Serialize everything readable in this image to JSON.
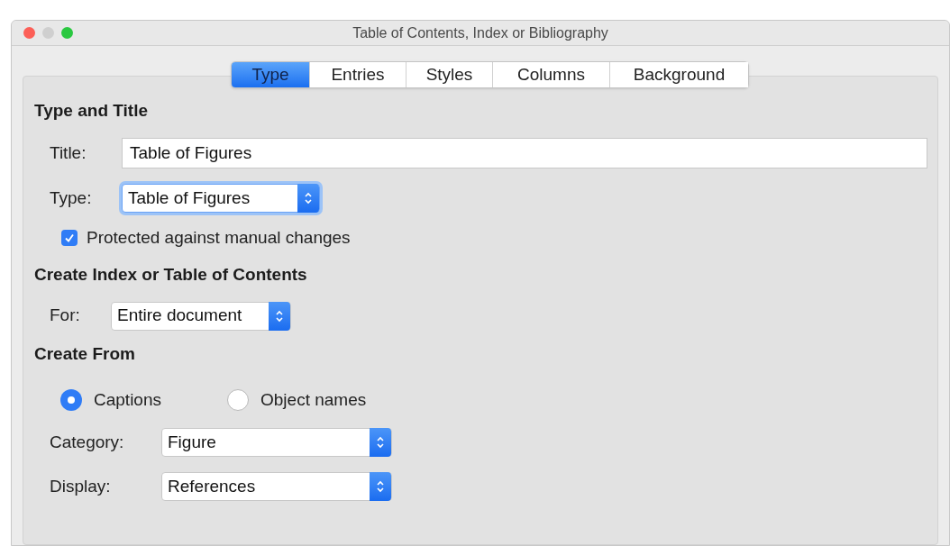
{
  "window": {
    "title": "Table of Contents, Index or Bibliography"
  },
  "tabs": [
    {
      "label": "Type",
      "selected": true
    },
    {
      "label": "Entries",
      "selected": false
    },
    {
      "label": "Styles",
      "selected": false
    },
    {
      "label": "Columns",
      "selected": false
    },
    {
      "label": "Background",
      "selected": false
    }
  ],
  "sections": [
    {
      "heading": "Type and Title",
      "rows": [
        {
          "kind": "text",
          "label": "Title:",
          "value": "Table of Figures"
        },
        {
          "kind": "select",
          "label": "Type:",
          "value": "Table of Figures",
          "focused": true
        },
        {
          "kind": "checkbox",
          "label": "Protected against manual changes",
          "checked": true
        }
      ]
    },
    {
      "heading": "Create Index or Table of Contents",
      "rows": [
        {
          "kind": "select",
          "label": "For:",
          "value": "Entire document",
          "focused": false
        }
      ]
    },
    {
      "heading": "Create From",
      "rows": [
        {
          "kind": "radios",
          "options": [
            {
              "label": "Captions",
              "selected": true
            },
            {
              "label": "Object names",
              "selected": false
            }
          ]
        },
        {
          "kind": "select",
          "label": "Category:",
          "value": "Figure",
          "focused": false
        },
        {
          "kind": "select",
          "label": "Display:",
          "value": "References",
          "focused": false
        }
      ]
    }
  ]
}
